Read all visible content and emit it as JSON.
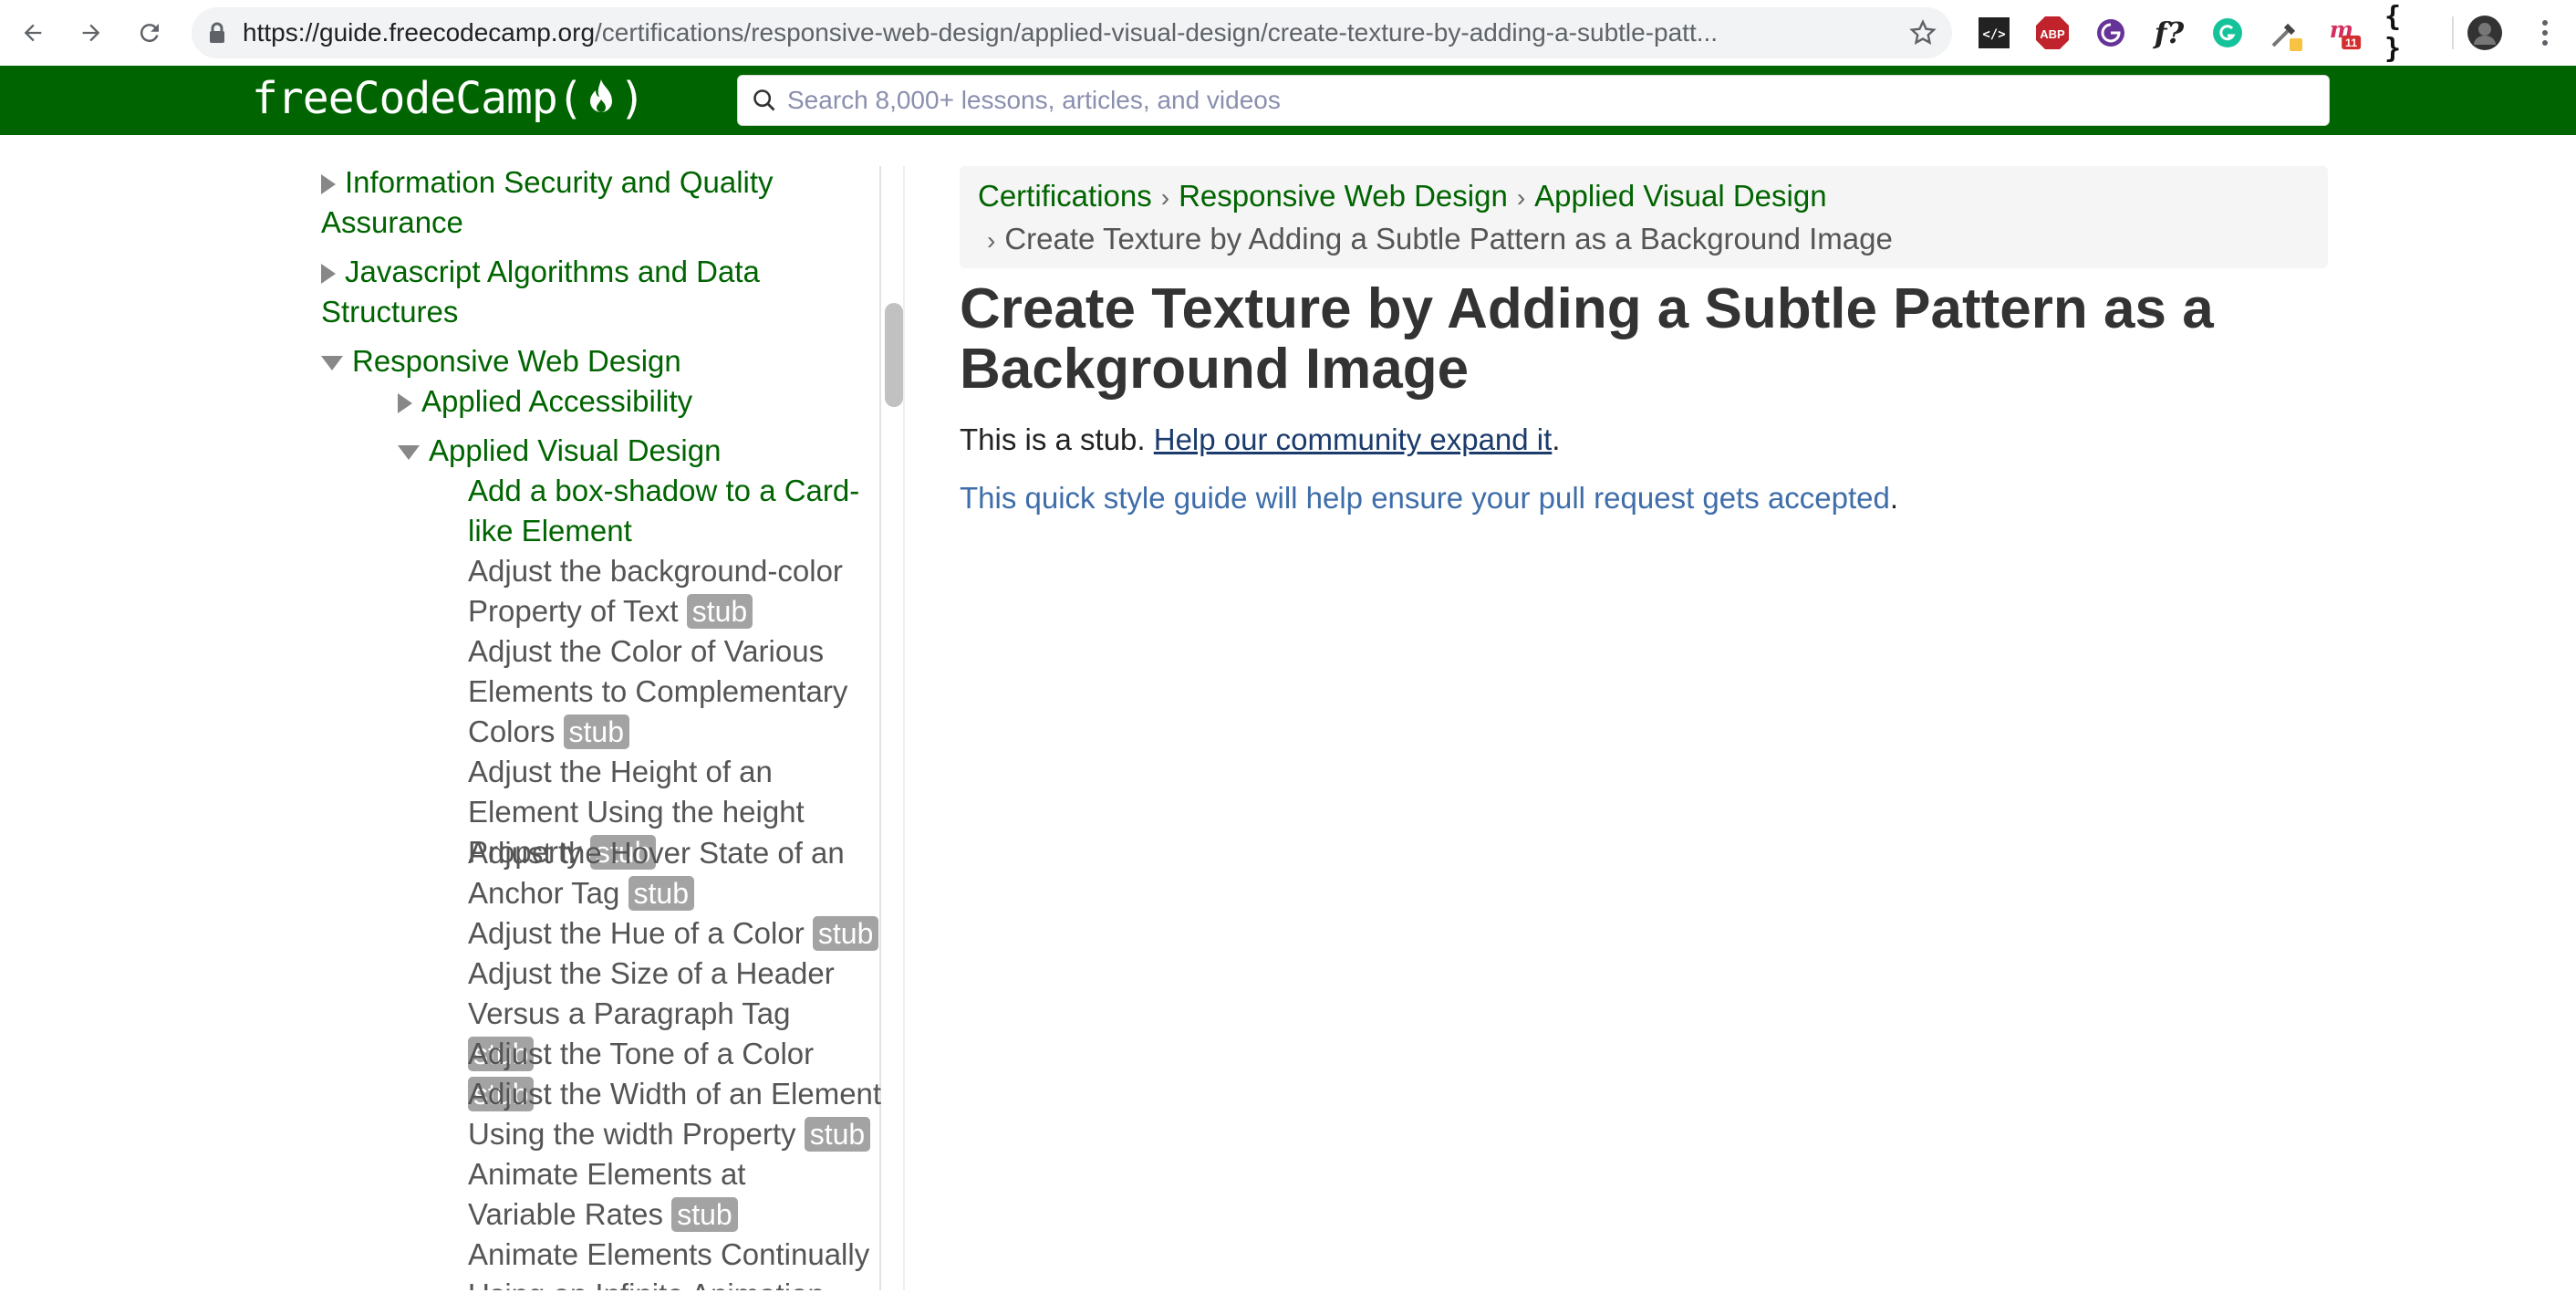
{
  "browser": {
    "url_host": "https://guide.freecodecamp.org",
    "url_path": "/certifications/responsive-web-design/applied-visual-design/create-texture-by-adding-a-subtle-patt...",
    "extensions": [
      "code-ext-icon",
      "adblock-icon",
      "gatsby-icon",
      "fonts-ninja-icon",
      "grammarly-icon",
      "eyedropper-icon",
      "mem-icon",
      "json-ext-icon"
    ],
    "ext_abp_label": "ABP",
    "ext_f_label": "f?",
    "ext_json_label": "{ }",
    "ext_mem_badge": "11"
  },
  "header": {
    "logo_text_left": "freeCodeCamp(",
    "logo_text_right": ")",
    "search_placeholder": "Search 8,000+ lessons, articles, and videos",
    "bg_color": "#006400"
  },
  "sidebar": {
    "top_items": [
      {
        "label": "Information Security and Quality Assurance"
      },
      {
        "label": "Javascript Algorithms and Data Structures"
      },
      {
        "label": "Responsive Web Design"
      }
    ],
    "sub_items": [
      {
        "label": "Applied Accessibility"
      },
      {
        "label": "Applied Visual Design"
      }
    ],
    "leaves": [
      {
        "label": "Add a box-shadow to a Card-like Element",
        "badge": ""
      },
      {
        "label": "Adjust the background-color Property of Text",
        "badge": "stub"
      },
      {
        "label": "Adjust the Color of Various Elements to Complementary Colors",
        "badge": "stub"
      },
      {
        "label": "Adjust the Height of an Element Using the height Property",
        "badge": "stub"
      },
      {
        "label": "Adjust the Hover State of an Anchor Tag",
        "badge": "stub"
      },
      {
        "label": "Adjust the Hue of a Color",
        "badge": "stub"
      },
      {
        "label": "Adjust the Size of a Header Versus a Paragraph Tag",
        "badge": "stub"
      },
      {
        "label": "Adjust the Tone of a Color",
        "badge": "stub"
      },
      {
        "label": "Adjust the Width of an Element Using the width Property",
        "badge": "stub"
      },
      {
        "label": "Animate Elements at Variable Rates",
        "badge": "stub"
      },
      {
        "label": "Animate Elements Continually Using an Infinite Animation",
        "badge": ""
      }
    ]
  },
  "breadcrumb": {
    "items": [
      "Certifications",
      "Responsive Web Design",
      "Applied Visual Design"
    ],
    "current": "Create Texture by Adding a Subtle Pattern as a Background Image",
    "separator": "›"
  },
  "article": {
    "title": "Create Texture by Adding a Subtle Pattern as a Background Image",
    "stub_prefix": "This is a stub. ",
    "stub_link": "Help our community expand it",
    "stub_suffix": ".",
    "guide_link": "This quick style guide will help ensure your pull request gets accepted",
    "guide_suffix": "."
  }
}
